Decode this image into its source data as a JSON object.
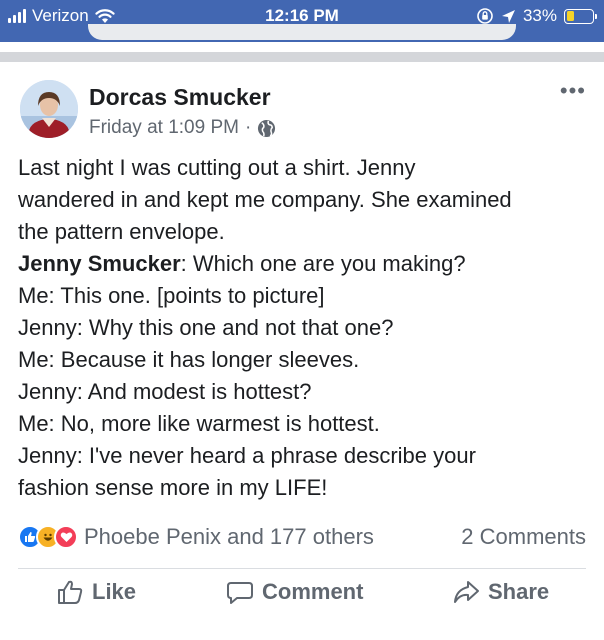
{
  "status_bar": {
    "carrier": "Verizon",
    "time": "12:16 PM",
    "battery": "33%",
    "battery_level": 0.33,
    "colors": {
      "bar": "#4267b2",
      "battery_fill": "#f5d328"
    }
  },
  "post": {
    "author": "Dorcas Smucker",
    "timestamp": "Friday at 1:09 PM",
    "meta_separator": "·",
    "privacy_icon": "globe-icon",
    "more_label": "•••",
    "body_lines": [
      {
        "bold": "",
        "text": "Last night I was cutting out a shirt. Jenny"
      },
      {
        "bold": "",
        "text": "wandered in and kept me company. She examined"
      },
      {
        "bold": "",
        "text": "the pattern envelope."
      },
      {
        "bold": "Jenny Smucker",
        "text": ": Which one are you making?"
      },
      {
        "bold": "",
        "text": "Me: This one. [points to picture]"
      },
      {
        "bold": "",
        "text": "Jenny: Why this one and not that one?"
      },
      {
        "bold": "",
        "text": "Me: Because it has longer sleeves."
      },
      {
        "bold": "",
        "text": "Jenny: And modest is hottest?"
      },
      {
        "bold": "",
        "text": "Me: No, more like warmest is hottest."
      },
      {
        "bold": "",
        "text": "Jenny: I've never heard a phrase describe your"
      },
      {
        "bold": "",
        "text": "fashion sense more in my LIFE!"
      }
    ],
    "reactions": {
      "icons": [
        "like-icon",
        "haha-icon",
        "love-icon"
      ],
      "names": "Phoebe Penix and 177 others",
      "comments": "2 Comments"
    },
    "actions": {
      "like": "Like",
      "comment": "Comment",
      "share": "Share"
    }
  }
}
